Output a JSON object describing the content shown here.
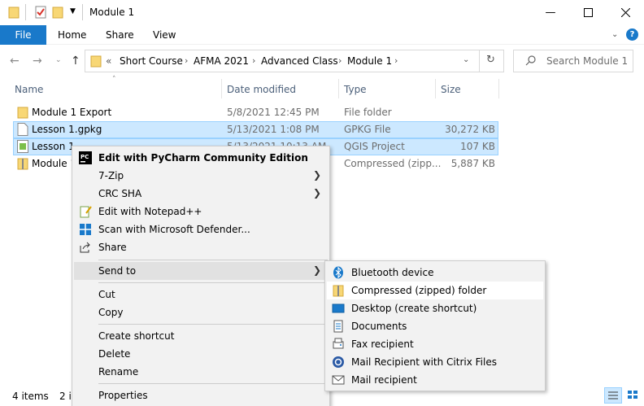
{
  "window": {
    "title": "Module 1"
  },
  "ribbon": {
    "file": "File",
    "tabs": [
      "Home",
      "Share",
      "View"
    ]
  },
  "address": {
    "overflow": "«",
    "crumbs": [
      "Short Course",
      "AFMA 2021",
      "Advanced Class",
      "Module 1"
    ],
    "search_placeholder": "Search Module 1"
  },
  "columns": {
    "name": "Name",
    "date": "Date modified",
    "type": "Type",
    "size": "Size"
  },
  "files": [
    {
      "name": "Module 1 Export",
      "date": "5/8/2021 12:45 PM",
      "type": "File folder",
      "size": ""
    },
    {
      "name": "Lesson 1.gpkg",
      "date": "5/13/2021 1:08 PM",
      "type": "GPKG File",
      "size": "30,272 KB"
    },
    {
      "name": "Lesson 1.",
      "date": "5/13/2021 10:13 AM",
      "type": "QGIS Project",
      "size": "107 KB"
    },
    {
      "name": "Module 1",
      "date": "",
      "type": "Compressed (zipp...",
      "size": "5,887 KB"
    }
  ],
  "status": {
    "count": "4 items",
    "selected": "2 i"
  },
  "context_menu": {
    "items": [
      {
        "label": "Edit with PyCharm Community Edition",
        "icon": "pycharm-icon"
      },
      {
        "label": "7-Zip",
        "submenu": true
      },
      {
        "label": "CRC SHA",
        "submenu": true
      },
      {
        "label": "Edit with Notepad++",
        "icon": "notepad-icon"
      },
      {
        "label": "Scan with Microsoft Defender...",
        "icon": "defender-icon"
      },
      {
        "label": "Share",
        "icon": "share-icon"
      },
      {
        "label": "Send to",
        "submenu": true
      },
      {
        "label": "Cut"
      },
      {
        "label": "Copy"
      },
      {
        "label": "Create shortcut"
      },
      {
        "label": "Delete"
      },
      {
        "label": "Rename"
      },
      {
        "label": "Properties"
      }
    ]
  },
  "send_to_menu": {
    "items": [
      {
        "label": "Bluetooth device",
        "icon": "bluetooth-icon"
      },
      {
        "label": "Compressed (zipped) folder",
        "icon": "zip-folder-icon"
      },
      {
        "label": "Desktop (create shortcut)",
        "icon": "desktop-icon"
      },
      {
        "label": "Documents",
        "icon": "documents-icon"
      },
      {
        "label": "Fax recipient",
        "icon": "fax-icon"
      },
      {
        "label": "Mail Recipient with Citrix Files",
        "icon": "citrix-icon"
      },
      {
        "label": "Mail recipient",
        "icon": "mail-icon"
      }
    ]
  },
  "colors": {
    "accent": "#1979ca",
    "selection": "#cce8ff",
    "folder": "#f8d775"
  }
}
